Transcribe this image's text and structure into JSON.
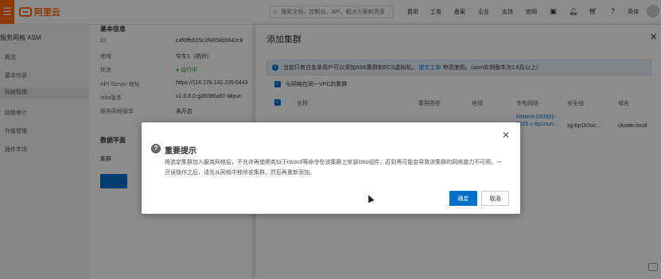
{
  "topbar": {
    "logo_text": "阿里云",
    "search_placeholder": "搜索文档、控制台、API、解决方案和资源",
    "nav": [
      "费用",
      "工单",
      "备案",
      "企业",
      "支持",
      "官网"
    ],
    "user_label": "简体"
  },
  "sidebar": {
    "title": "服务网格 ASM",
    "items": [
      "概览",
      "基本信息",
      "网格管理",
      "网格审计",
      "升级管理",
      "插件市场"
    ]
  },
  "content": {
    "section_basic": "基本信息",
    "rows": [
      {
        "label": "ID",
        "value": "c4f0ffb515c2f4958b5642c8"
      },
      {
        "label": "地域",
        "value": "华东1（杭州）"
      },
      {
        "label": "状态",
        "value": "● 运行中"
      },
      {
        "label": "API Server 地址",
        "value": "https://118.178.142.235:6443"
      },
      {
        "label": "Istio版本",
        "value": "v1.6.8.0-g35086a87-aliyun"
      },
      {
        "label": "服务网格版本",
        "value": "未开启"
      }
    ],
    "section_data": "数据平面",
    "tab_label": "集群"
  },
  "panel": {
    "title": "添加集群",
    "notice_before": "当前只有白名单用户可以添加ASK集群和ECS虚拟机。",
    "notice_link": "提交工单",
    "notice_after": "申请使用。（asm实例版本为1.6及以上）",
    "same_vpc_label": "与网格在同一VPC的集群",
    "columns": [
      "名称",
      "集群类型",
      "地域",
      "专有网络",
      "安全组",
      "域名"
    ],
    "row": {
      "vpc": "k8stest-200901-2325 c-bp1nuo...",
      "security_group": "sg-bp1b3uc...",
      "domain": "cluster.local"
    }
  },
  "dialog": {
    "title": "重要提示",
    "body": "将选定集群加入服务网格后，不允许再使用类似于istioctl等命令在该集群上安装Istio组件，否则将可能会导致该集群的网格能力不可用。一旦误操作之后，请先从网格中移除该集群，然后再重新添加。",
    "ok_label": "确定",
    "cancel_label": "取消"
  },
  "colors": {
    "brand": "#ff6a00",
    "primary": "#0070cc"
  }
}
